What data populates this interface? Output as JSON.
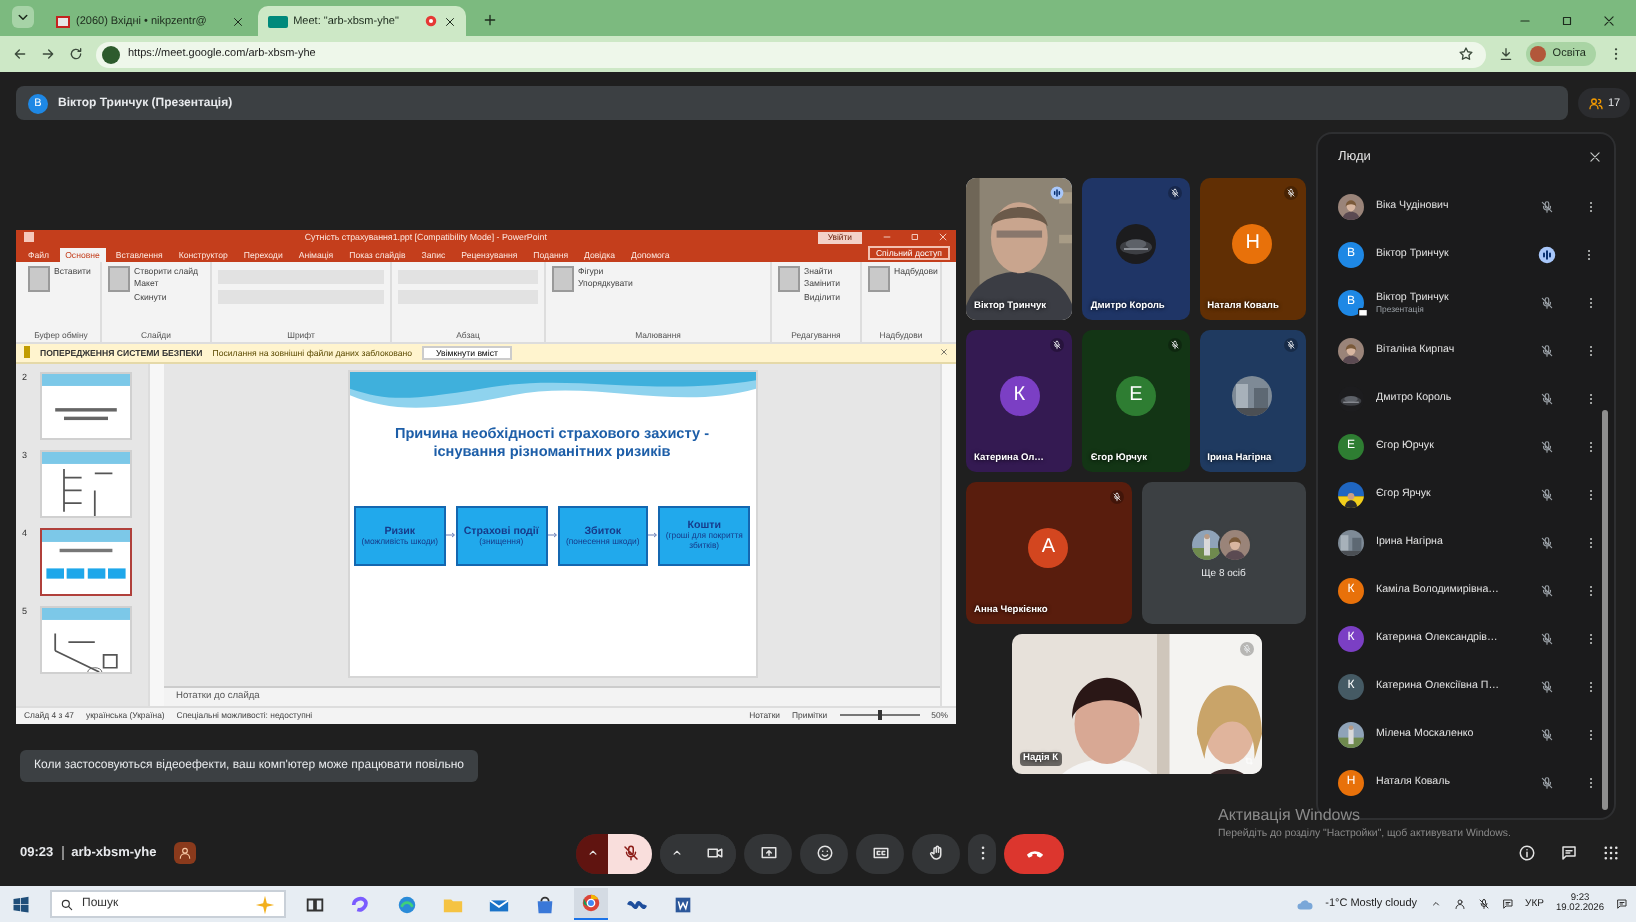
{
  "browser": {
    "tabs": [
      {
        "title": "(2060) Вхідні • nikpzentr@",
        "selected": false,
        "recording": false
      },
      {
        "title": "Meet: \"arb-xbsm-yhe\"",
        "selected": true,
        "recording": true
      }
    ],
    "url": "https://meet.google.com/arb-xbsm-yhe",
    "profile": "Освіта"
  },
  "meet": {
    "presenter_bar": {
      "avatar": "В",
      "title": "Віктор Тринчук (Презентація)",
      "participant_count": "17"
    },
    "presentation": {
      "window_title": "Сутність страхування1.ppt [Compatibility Mode] - PowerPoint",
      "sign_in": "Увійти",
      "ribbon_tabs": [
        {
          "label": "Файл",
          "selected": false
        },
        {
          "label": "Основне",
          "selected": true
        },
        {
          "label": "Вставлення",
          "selected": false
        },
        {
          "label": "Конструктор",
          "selected": false
        },
        {
          "label": "Переходи",
          "selected": false
        },
        {
          "label": "Анімація",
          "selected": false
        },
        {
          "label": "Показ слайдів",
          "selected": false
        },
        {
          "label": "Запис",
          "selected": false
        },
        {
          "label": "Рецензування",
          "selected": false
        },
        {
          "label": "Подання",
          "selected": false
        },
        {
          "label": "Довідка",
          "selected": false
        },
        {
          "label": "Допомога",
          "selected": false
        }
      ],
      "share": "Спільний доступ",
      "ribbon_groups": [
        {
          "label": "Буфер обміну",
          "items": [
            "Вставити"
          ]
        },
        {
          "label": "Слайди",
          "items": [
            "Створити слайд",
            "Макет",
            "Скинути"
          ]
        },
        {
          "label": "Шрифт"
        },
        {
          "label": "Абзац"
        },
        {
          "label": "Малювання",
          "items": [
            "Фігури",
            "Упорядкувати"
          ]
        },
        {
          "label": "Редагування",
          "items": [
            "Знайти",
            "Замінити",
            "Виділити"
          ]
        },
        {
          "label": "Надбудови",
          "items": [
            "Надбудови"
          ]
        }
      ],
      "security": {
        "label": "ПОПЕРЕДЖЕННЯ СИСТЕМИ БЕЗПЕКИ",
        "message": "Посилання на зовнішні файли даних заблоковано",
        "button": "Увімкнути вміст"
      },
      "thumbnails": [
        {
          "number": "2",
          "kind": "text",
          "selected": false
        },
        {
          "number": "3",
          "kind": "diagram",
          "selected": false
        },
        {
          "number": "4",
          "kind": "boxes",
          "selected": true
        },
        {
          "number": "5",
          "kind": "scheme",
          "selected": false
        }
      ],
      "slide": {
        "title": "Причина необхідності страхового захисту - існування різноманітних ризиків",
        "boxes": [
          {
            "title": "Ризик",
            "note": "(можливість шкоди)"
          },
          {
            "title": "Страхові події",
            "note": "(знищення)"
          },
          {
            "title": "Збиток",
            "note": "(понесення шкоди)"
          },
          {
            "title": "Кошти",
            "note": "(гроші для покриття збитків)"
          }
        ]
      },
      "notes_placeholder": "Нотатки до слайда",
      "status": {
        "slide": "Слайд 4 з 47",
        "language": "українська (Україна)",
        "accessibility": "Спеціальні можливості: недоступні",
        "notes": "Нотатки",
        "comments": "Примітки",
        "zoom": "50%",
        "zoom_slider": {
          "level": 0.5
        }
      }
    },
    "tile_rows": [
      [
        {
          "kind": "video",
          "name": "Віктор Тринчук",
          "muted": false
        },
        {
          "name": "Дмитро Король",
          "color": "#1f3566",
          "muted": true
        },
        {
          "kind": "letter",
          "name": "Наталя Коваль",
          "letter": "Н",
          "color": "#e8710a",
          "muted": true
        }
      ],
      [
        {
          "kind": "letter",
          "name": "Катерина Ол…",
          "letter": "К",
          "color": "#7b3fc4",
          "muted": true
        },
        {
          "kind": "letter",
          "name": "Єгор Юрчук",
          "letter": "Е",
          "color": "#2e7d32",
          "muted": true
        },
        {
          "name": "Ірина Нагірна",
          "color": "#1f3a60",
          "muted": true
        }
      ],
      [
        {
          "kind": "letter",
          "name": "Анна Черкієнко",
          "letter": "А",
          "color": "#d3461f",
          "muted": true
        },
        {
          "kind": "more",
          "label": "Ще 8 осіб"
        }
      ]
    ],
    "self_tile": {
      "name": "Надія К",
      "muted": true
    },
    "people_panel": {
      "title": "Люди",
      "people": [
        {
          "name": "Віка Чудінович",
          "muted": true,
          "presenting": false
        },
        {
          "name": "Віктор Тринчук",
          "kind": "letter",
          "letter": "В",
          "color": "#1e88e5",
          "muted": false,
          "presenting": false
        },
        {
          "name": "Віктор Тринчук",
          "subtitle": "Презентація",
          "kind": "letter",
          "letter": "В",
          "color": "#1e88e5",
          "muted": true,
          "presenting": true
        },
        {
          "name": "Віталіна Кирпач",
          "muted": true,
          "presenting": false
        },
        {
          "name": "Дмитро Король",
          "muted": true,
          "presenting": false
        },
        {
          "name": "Єгор Юрчук",
          "kind": "letter",
          "letter": "Е",
          "color": "#2e7d32",
          "muted": true,
          "presenting": false
        },
        {
          "name": "Єгор Ярчук",
          "muted": true,
          "presenting": false
        },
        {
          "name": "Ірина Нагірна",
          "muted": true,
          "presenting": false
        },
        {
          "name": "Каміла Володимирівна…",
          "kind": "letter",
          "letter": "К",
          "color": "#e8710a",
          "muted": true,
          "presenting": false
        },
        {
          "name": "Катерина Олександрів…",
          "kind": "letter",
          "letter": "К",
          "color": "#7b3fc4",
          "muted": true,
          "presenting": false
        },
        {
          "name": "Катерина Олексіївна П…",
          "kind": "letter",
          "letter": "К",
          "color": "#455a64",
          "muted": true,
          "presenting": false
        },
        {
          "name": "Мілена Москаленко",
          "muted": true,
          "presenting": false
        },
        {
          "name": "Наталя Коваль",
          "kind": "letter",
          "letter": "Н",
          "color": "#e8710a",
          "muted": true,
          "presenting": false
        }
      ]
    },
    "toast": "Коли застосовуються відеоефекти, ваш комп'ютер може працювати повільно",
    "meeting_time": "09:23",
    "meeting_code": "arb-xbsm-yhe",
    "mic_on": false
  },
  "windows_notice": {
    "title": "Активація Windows",
    "text": "Перейдіть до розділу \"Настройки\", щоб активувати Windows."
  },
  "taskbar": {
    "search_placeholder": "Пошук",
    "weather": "-1°C Mostly cloudy",
    "language": "УКР",
    "time": "9:23",
    "date": "19.02.2026"
  }
}
